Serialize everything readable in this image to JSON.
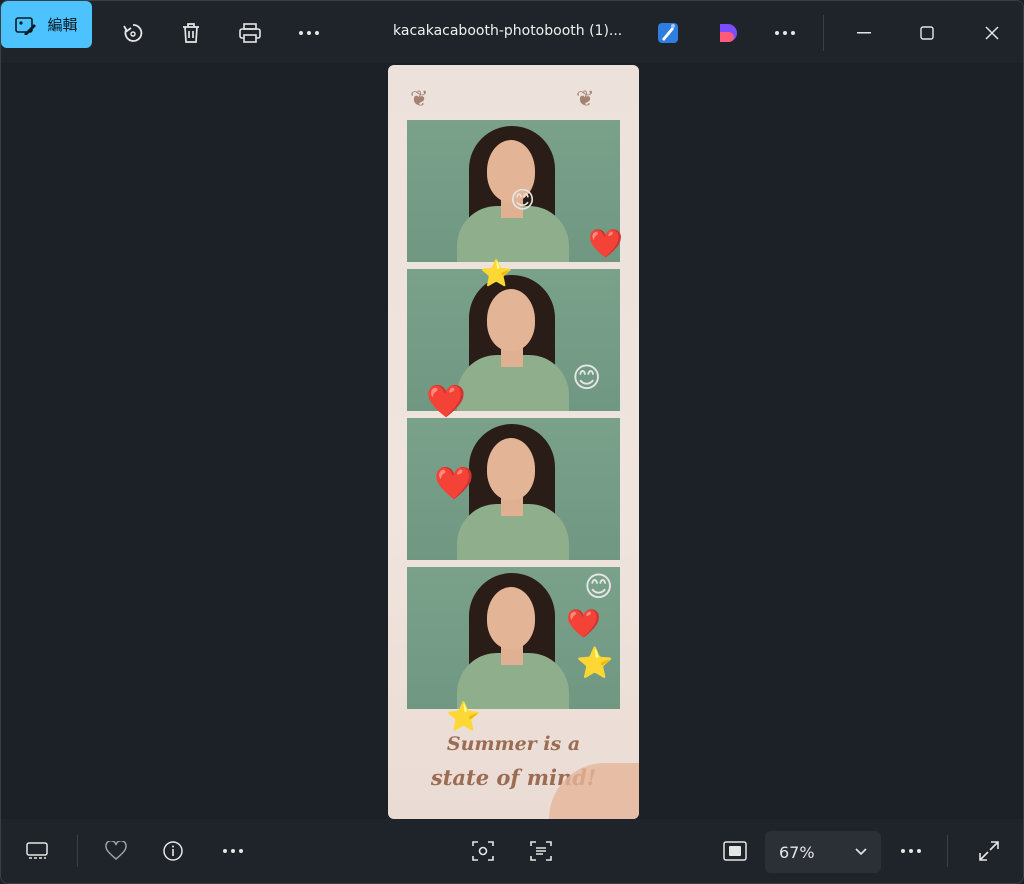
{
  "toolbar": {
    "edit_label": "編輯",
    "title": "kacakacabooth-photobooth (1)..."
  },
  "photo_strip": {
    "caption_line1": "Summer is a",
    "caption_line2": "state of mind!"
  },
  "bottombar": {
    "zoom_value": "67%"
  },
  "icons": {
    "edit": "edit-image-icon",
    "rotate": "rotate-icon",
    "delete": "trash-icon",
    "print": "print-icon",
    "more": "more-icon",
    "designer": "designer-icon",
    "clipchamp": "clipchamp-icon",
    "minimize": "minimize-icon",
    "maximize": "maximize-icon",
    "close": "close-icon",
    "filmstrip": "filmstrip-icon",
    "favorite": "heart-icon",
    "info": "info-icon",
    "visual_search": "visual-search-icon",
    "scan_text": "scan-text-icon",
    "actual_size": "actual-size-icon",
    "fullscreen": "fullscreen-icon"
  },
  "colors": {
    "accent": "#4cc2ff",
    "background": "#1b2126"
  }
}
